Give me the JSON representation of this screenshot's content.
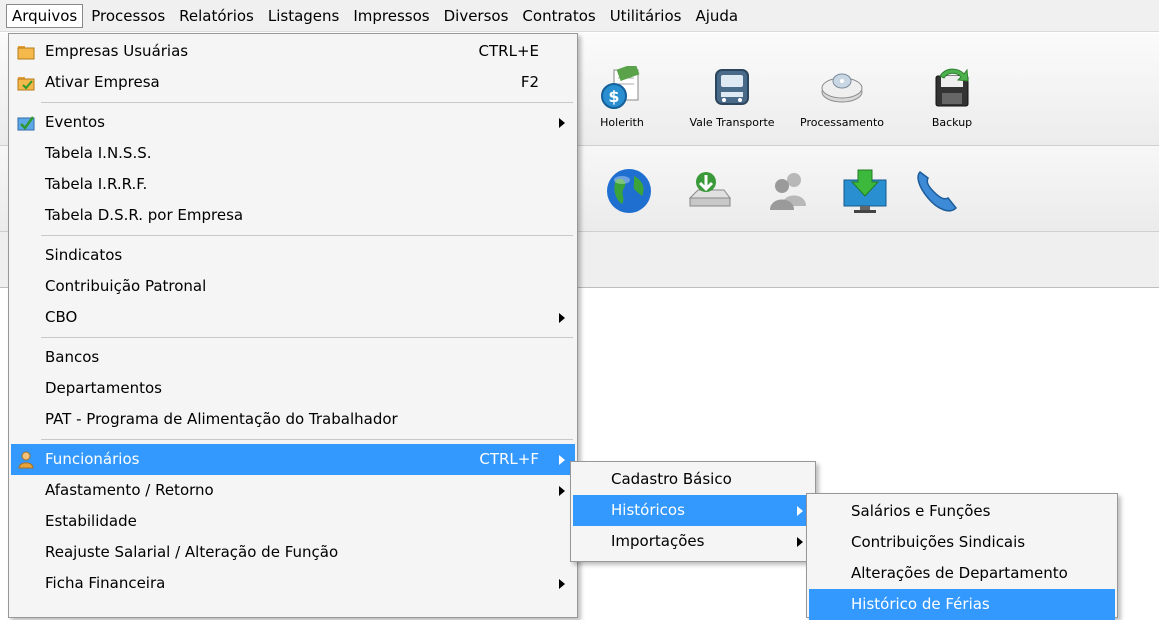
{
  "menubar": {
    "items": [
      "Arquivos",
      "Processos",
      "Relatórios",
      "Listagens",
      "Impressos",
      "Diversos",
      "Contratos",
      "Utilitários",
      "Ajuda"
    ]
  },
  "toolbar": {
    "buttons": [
      {
        "label": "Holerith",
        "icon": "holerith-icon"
      },
      {
        "label": "Vale Transporte",
        "icon": "bus-icon"
      },
      {
        "label": "Processamento",
        "icon": "processing-icon"
      },
      {
        "label": "Backup",
        "icon": "backup-icon"
      }
    ],
    "row2_icons": [
      "globe-icon",
      "network-drive-icon",
      "users-icon",
      "download-monitor-icon",
      "phone-icon"
    ]
  },
  "arquivos_menu": {
    "empresas_usuarias": {
      "label": "Empresas Usuárias",
      "shortcut": "CTRL+E"
    },
    "ativar_empresa": {
      "label": "Ativar Empresa",
      "shortcut": "F2"
    },
    "eventos": "Eventos",
    "tabela_inss": "Tabela I.N.S.S.",
    "tabela_irrf": "Tabela I.R.R.F.",
    "tabela_dsr": "Tabela D.S.R. por Empresa",
    "sindicatos": "Sindicatos",
    "contribuicao_patronal": "Contribuição Patronal",
    "cbo": "CBO",
    "bancos": "Bancos",
    "departamentos": "Departamentos",
    "pat": "PAT - Programa de Alimentação do Trabalhador",
    "funcionarios": {
      "label": "Funcionários",
      "shortcut": "CTRL+F"
    },
    "afastamento": "Afastamento / Retorno",
    "estabilidade": "Estabilidade",
    "reajuste": "Reajuste Salarial / Alteração de Função",
    "ficha_financeira": "Ficha Financeira"
  },
  "funcionarios_submenu": [
    "Cadastro Básico",
    "Históricos",
    "Importações"
  ],
  "historicos_submenu": [
    "Salários e Funções",
    "Contribuições Sindicais",
    "Alterações de Departamento",
    "Histórico de Férias"
  ],
  "colors": {
    "selection": "#3399ff"
  }
}
